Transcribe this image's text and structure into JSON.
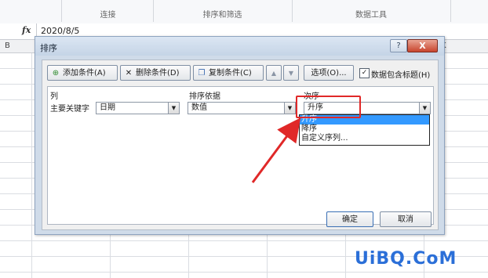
{
  "ribbon": {
    "groups": [
      "连接",
      "排序和筛选",
      "数据工具"
    ]
  },
  "formula_bar": {
    "fx_label": "fx",
    "value": "2020/8/5"
  },
  "sheet": {
    "columns": [
      "B",
      "K"
    ]
  },
  "dialog": {
    "title": "排序",
    "help_label": "?",
    "close_label": "X",
    "toolbar": {
      "add_label": "添加条件(A)",
      "delete_label": "删除条件(D)",
      "copy_label": "复制条件(C)",
      "up_label": "▲",
      "down_label": "▼",
      "options_label": "选项(O)...",
      "header_checkbox_label": "数据包含标题(H)",
      "header_checked": true
    },
    "headers": {
      "column": "列",
      "sort_on": "排序依据",
      "order": "次序"
    },
    "row": {
      "label": "主要关键字",
      "column_value": "日期",
      "sort_on_value": "数值",
      "order_value": "升序"
    },
    "order_options": [
      "升序",
      "降序",
      "自定义序列..."
    ],
    "selected_option": "升序",
    "ok_label": "确定",
    "cancel_label": "取消"
  },
  "watermark": "UiBQ.CoM",
  "colors": {
    "highlight": "#e02828",
    "selection": "#3399ff",
    "watermark": "#2b6fd8"
  }
}
